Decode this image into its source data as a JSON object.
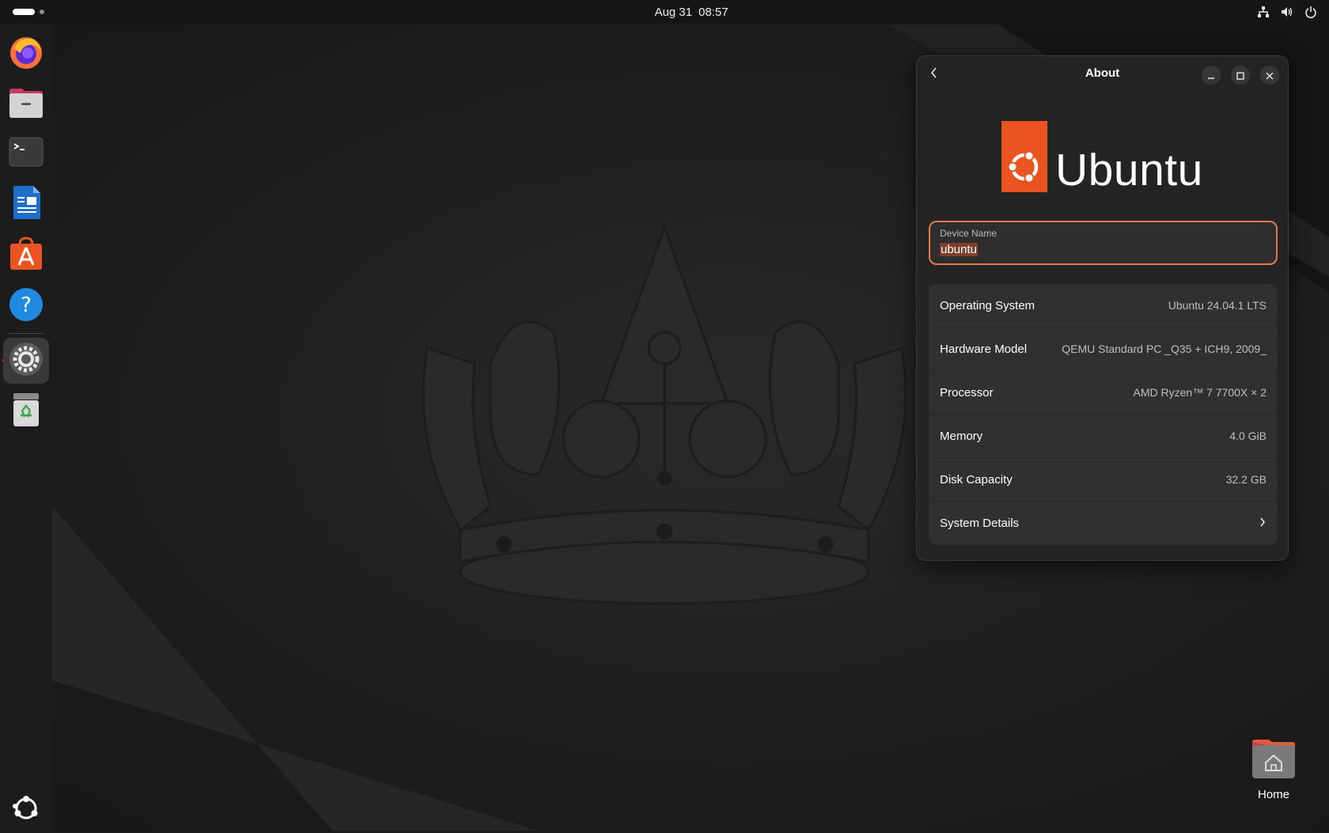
{
  "topbar": {
    "date": "Aug 31",
    "time": "08:57",
    "tray_icons": [
      "network-icon",
      "volume-icon",
      "power-icon"
    ]
  },
  "dock": {
    "items": [
      {
        "name": "firefox",
        "icon": "firefox-icon"
      },
      {
        "name": "files",
        "icon": "files-icon"
      },
      {
        "name": "terminal",
        "icon": "terminal-icon"
      },
      {
        "name": "libreoffice-writer",
        "icon": "writer-icon"
      },
      {
        "name": "app-center",
        "icon": "app-center-icon"
      },
      {
        "name": "help",
        "icon": "help-icon"
      },
      {
        "name": "settings",
        "icon": "settings-icon",
        "active": true
      },
      {
        "name": "trash",
        "icon": "trash-icon"
      }
    ],
    "show_apps_icon": "ubuntu-apps-icon"
  },
  "desktop": {
    "home_label": "Home"
  },
  "about_window": {
    "title": "About",
    "logo_text": "Ubuntu",
    "device_name": {
      "label": "Device Name",
      "value": "ubuntu"
    },
    "rows": [
      {
        "key": "Operating System",
        "value": "Ubuntu 24.04.1 LTS"
      },
      {
        "key": "Hardware Model",
        "value": "QEMU Standard PC _Q35 + ICH9, 2009_"
      },
      {
        "key": "Processor",
        "value": "AMD Ryzen™ 7 7700X × 2"
      },
      {
        "key": "Memory",
        "value": "4.0 GiB"
      },
      {
        "key": "Disk Capacity",
        "value": "32.2 GB"
      },
      {
        "key": "System Details",
        "value": ""
      }
    ]
  },
  "colors": {
    "accent": "#e95420",
    "window_bg": "#242424",
    "row_bg": "#303030"
  }
}
